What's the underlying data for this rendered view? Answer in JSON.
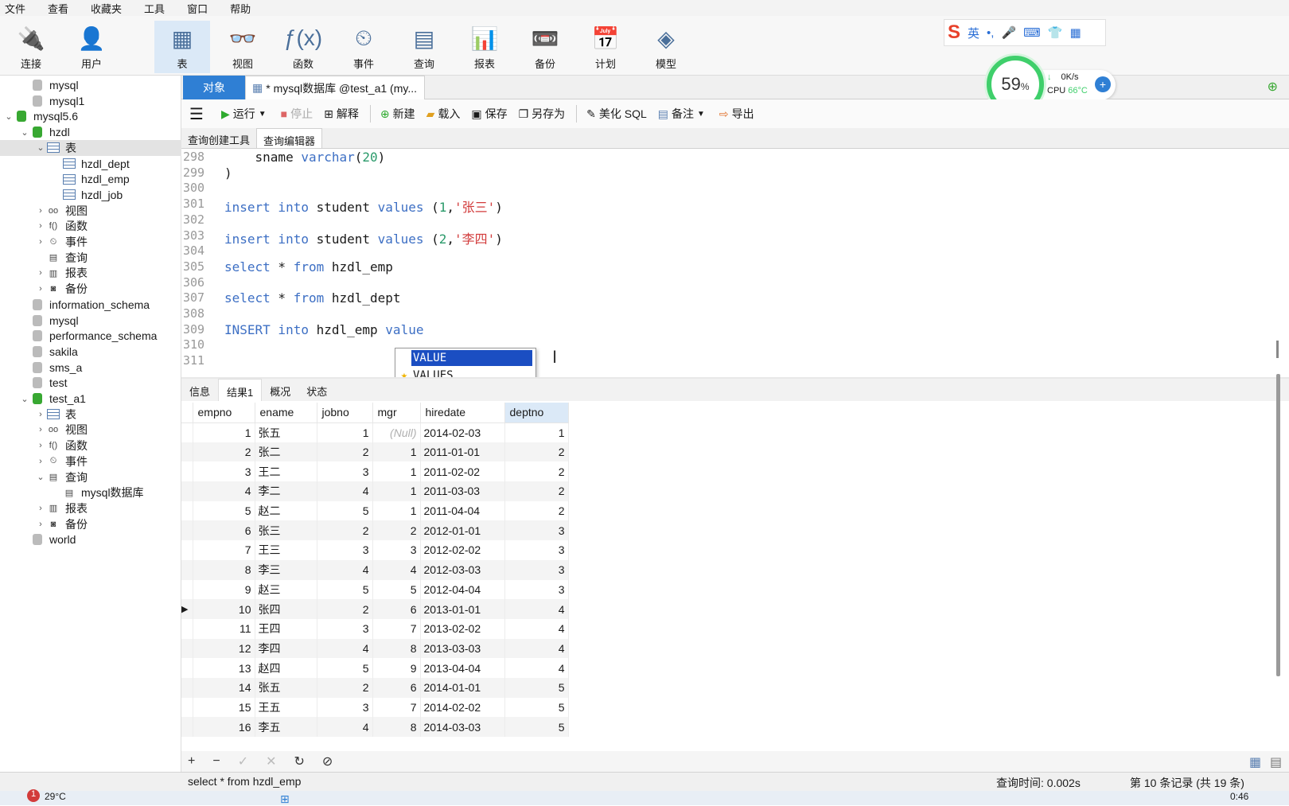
{
  "menu": [
    "文件",
    "查看",
    "收藏夹",
    "工具",
    "窗口",
    "帮助"
  ],
  "toolbar": {
    "buttons": [
      {
        "label": "连接",
        "icon": "plug-icon"
      },
      {
        "label": "用户",
        "icon": "user-icon"
      },
      {
        "label": "表",
        "icon": "table-icon"
      },
      {
        "label": "视图",
        "icon": "view-icon"
      },
      {
        "label": "函数",
        "icon": "function-icon"
      },
      {
        "label": "事件",
        "icon": "event-icon"
      },
      {
        "label": "查询",
        "icon": "query-icon"
      },
      {
        "label": "报表",
        "icon": "report-icon"
      },
      {
        "label": "备份",
        "icon": "backup-icon"
      },
      {
        "label": "计划",
        "icon": "calendar-icon"
      },
      {
        "label": "模型",
        "icon": "model-icon"
      }
    ]
  },
  "ime": {
    "logo": "S",
    "lang": "英",
    "punct": "•,"
  },
  "perf": {
    "percent": "59",
    "percent_unit": "%",
    "speed": "0K/s",
    "cpu_label": "CPU",
    "cpu_temp": "66°C"
  },
  "sidebar": {
    "items": [
      {
        "label": "mysql",
        "indent": 1,
        "arrow": "",
        "type": "db-gray"
      },
      {
        "label": "mysql1",
        "indent": 1,
        "arrow": "",
        "type": "db-gray"
      },
      {
        "label": "mysql5.6",
        "indent": 0,
        "arrow": "v",
        "type": "db-green"
      },
      {
        "label": "hzdl",
        "indent": 1,
        "arrow": "v",
        "type": "db-green"
      },
      {
        "label": "表",
        "indent": 2,
        "arrow": "v",
        "type": "table",
        "selected": true
      },
      {
        "label": "hzdl_dept",
        "indent": 3,
        "arrow": "",
        "type": "table"
      },
      {
        "label": "hzdl_emp",
        "indent": 3,
        "arrow": "",
        "type": "table"
      },
      {
        "label": "hzdl_job",
        "indent": 3,
        "arrow": "",
        "type": "table"
      },
      {
        "label": "视图",
        "indent": 2,
        "arrow": ">",
        "type": "view"
      },
      {
        "label": "函数",
        "indent": 2,
        "arrow": ">",
        "type": "func"
      },
      {
        "label": "事件",
        "indent": 2,
        "arrow": ">",
        "type": "event"
      },
      {
        "label": "查询",
        "indent": 2,
        "arrow": "",
        "type": "query"
      },
      {
        "label": "报表",
        "indent": 2,
        "arrow": ">",
        "type": "report"
      },
      {
        "label": "备份",
        "indent": 2,
        "arrow": ">",
        "type": "backup"
      },
      {
        "label": "information_schema",
        "indent": 1,
        "arrow": "",
        "type": "db-gray"
      },
      {
        "label": "mysql",
        "indent": 1,
        "arrow": "",
        "type": "db-gray"
      },
      {
        "label": "performance_schema",
        "indent": 1,
        "arrow": "",
        "type": "db-gray"
      },
      {
        "label": "sakila",
        "indent": 1,
        "arrow": "",
        "type": "db-gray"
      },
      {
        "label": "sms_a",
        "indent": 1,
        "arrow": "",
        "type": "db-gray"
      },
      {
        "label": "test",
        "indent": 1,
        "arrow": "",
        "type": "db-gray"
      },
      {
        "label": "test_a1",
        "indent": 1,
        "arrow": "v",
        "type": "db-green"
      },
      {
        "label": "表",
        "indent": 2,
        "arrow": ">",
        "type": "table"
      },
      {
        "label": "视图",
        "indent": 2,
        "arrow": ">",
        "type": "view"
      },
      {
        "label": "函数",
        "indent": 2,
        "arrow": ">",
        "type": "func"
      },
      {
        "label": "事件",
        "indent": 2,
        "arrow": ">",
        "type": "event"
      },
      {
        "label": "查询",
        "indent": 2,
        "arrow": "v",
        "type": "query"
      },
      {
        "label": "mysql数据库",
        "indent": 3,
        "arrow": "",
        "type": "query"
      },
      {
        "label": "报表",
        "indent": 2,
        "arrow": ">",
        "type": "report"
      },
      {
        "label": "备份",
        "indent": 2,
        "arrow": ">",
        "type": "backup"
      },
      {
        "label": "world",
        "indent": 1,
        "arrow": "",
        "type": "db-gray"
      }
    ]
  },
  "tabs": {
    "objects": "对象",
    "query": "* mysql数据库 @test_a1 (my..."
  },
  "qtoolbar": {
    "run": "运行",
    "stop": "停止",
    "explain": "解释",
    "new": "新建",
    "load": "载入",
    "save": "保存",
    "save_as": "另存为",
    "beautify": "美化 SQL",
    "comment": "备注",
    "export": "导出"
  },
  "subtabs": {
    "builder": "查询创建工具",
    "editor": "查询编辑器"
  },
  "editor": {
    "lines": [
      {
        "n": "298",
        "parts": [
          [
            "    sname ",
            ""
          ],
          [
            "varchar",
            "kw"
          ],
          [
            "(",
            ""
          ],
          [
            "20",
            "num"
          ],
          [
            ")",
            ""
          ]
        ]
      },
      {
        "n": "299",
        "parts": [
          [
            ")",
            ""
          ]
        ]
      },
      {
        "n": "300",
        "parts": []
      },
      {
        "n": "301",
        "parts": [
          [
            "insert into",
            "kw"
          ],
          [
            " student ",
            ""
          ],
          [
            "values",
            "kw"
          ],
          [
            " (",
            ""
          ],
          [
            "1",
            "num"
          ],
          [
            ",",
            ""
          ],
          [
            "'张三'",
            "str"
          ],
          [
            ")",
            ""
          ]
        ]
      },
      {
        "n": "302",
        "parts": []
      },
      {
        "n": "303",
        "parts": [
          [
            "insert into",
            "kw"
          ],
          [
            " student ",
            ""
          ],
          [
            "values",
            "kw"
          ],
          [
            " (",
            ""
          ],
          [
            "2",
            "num"
          ],
          [
            ",",
            ""
          ],
          [
            "'李四'",
            "str"
          ],
          [
            ")",
            ""
          ]
        ]
      },
      {
        "n": "304",
        "parts": []
      },
      {
        "n": "305",
        "parts": [
          [
            "select",
            "kw"
          ],
          [
            " * ",
            ""
          ],
          [
            "from",
            "kw"
          ],
          [
            " hzdl_emp",
            ""
          ]
        ]
      },
      {
        "n": "306",
        "parts": []
      },
      {
        "n": "307",
        "parts": [
          [
            "select",
            "kw"
          ],
          [
            " * ",
            ""
          ],
          [
            "from",
            "kw"
          ],
          [
            " hzdl_dept",
            ""
          ]
        ]
      },
      {
        "n": "308",
        "parts": []
      },
      {
        "n": "309",
        "parts": [
          [
            "INSERT into",
            "kw"
          ],
          [
            " hzdl_emp ",
            ""
          ],
          [
            "value",
            "kw"
          ]
        ]
      },
      {
        "n": "310",
        "parts": []
      },
      {
        "n": "311",
        "parts": []
      }
    ]
  },
  "autocomplete": {
    "options": [
      "VALUE",
      "VALUES"
    ]
  },
  "results": {
    "tabs": [
      "信息",
      "结果1",
      "概况",
      "状态"
    ],
    "columns": [
      "empno",
      "ename",
      "jobno",
      "mgr",
      "hiredate",
      "deptno"
    ],
    "rows": [
      [
        "1",
        "张五",
        "1",
        "(Null)",
        "2014-02-03",
        "1"
      ],
      [
        "2",
        "张二",
        "2",
        "1",
        "2011-01-01",
        "2"
      ],
      [
        "3",
        "王二",
        "3",
        "1",
        "2011-02-02",
        "2"
      ],
      [
        "4",
        "李二",
        "4",
        "1",
        "2011-03-03",
        "2"
      ],
      [
        "5",
        "赵二",
        "5",
        "1",
        "2011-04-04",
        "2"
      ],
      [
        "6",
        "张三",
        "2",
        "2",
        "2012-01-01",
        "3"
      ],
      [
        "7",
        "王三",
        "3",
        "3",
        "2012-02-02",
        "3"
      ],
      [
        "8",
        "李三",
        "4",
        "4",
        "2012-03-03",
        "3"
      ],
      [
        "9",
        "赵三",
        "5",
        "5",
        "2012-04-04",
        "3"
      ],
      [
        "10",
        "张四",
        "2",
        "6",
        "2013-01-01",
        "4"
      ],
      [
        "11",
        "王四",
        "3",
        "7",
        "2013-02-02",
        "4"
      ],
      [
        "12",
        "李四",
        "4",
        "8",
        "2013-03-03",
        "4"
      ],
      [
        "13",
        "赵四",
        "5",
        "9",
        "2013-04-04",
        "4"
      ],
      [
        "14",
        "张五",
        "2",
        "6",
        "2014-01-01",
        "5"
      ],
      [
        "15",
        "王五",
        "3",
        "7",
        "2014-02-02",
        "5"
      ],
      [
        "16",
        "李五",
        "4",
        "8",
        "2014-03-03",
        "5"
      ]
    ],
    "current_row": 9
  },
  "bottombar": {
    "buttons": [
      "+",
      "−",
      "✓",
      "✕",
      "↻",
      "⊘"
    ]
  },
  "status": {
    "sql": "select * from hzdl_emp",
    "query_time": "查询时间: 0.002s",
    "record": "第 10 条记录 (共 19 条)"
  },
  "taskbar": {
    "weather_badge": "1",
    "weather": "29°C",
    "clock": "0:46"
  }
}
